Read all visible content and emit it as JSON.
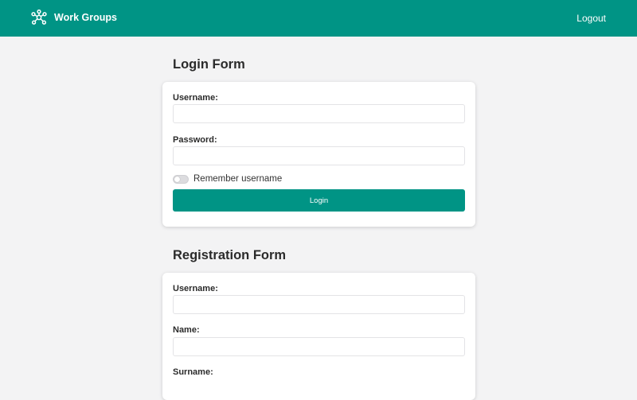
{
  "app": {
    "name": "Work Groups",
    "brand_icon": "network-nodes-icon"
  },
  "header": {
    "logout_label": "Logout"
  },
  "login": {
    "title": "Login Form",
    "username_label": "Username:",
    "username_value": "",
    "password_label": "Password:",
    "password_value": "",
    "remember_label": "Remember username",
    "remember_checked": false,
    "submit_label": "Login"
  },
  "registration": {
    "title": "Registration Form",
    "username_label": "Username:",
    "username_value": "",
    "name_label": "Name:",
    "name_value": "",
    "surname_label": "Surname:"
  },
  "colors": {
    "primary": "#009485",
    "background": "#f3f3f4",
    "card": "#ffffff"
  }
}
